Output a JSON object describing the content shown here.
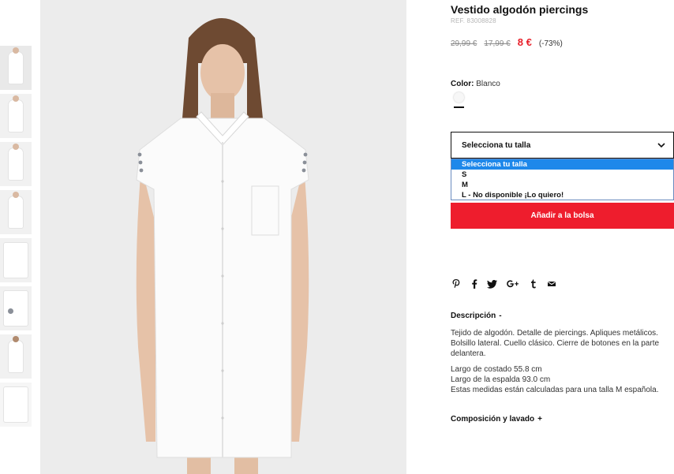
{
  "product": {
    "title": "Vestido algodón piercings",
    "ref": "REF. 83008828",
    "price_original": "29,99 €",
    "price_previous": "17,99 €",
    "price_now": "8 €",
    "discount": "(-73%)"
  },
  "color": {
    "label": "Color:",
    "value": "Blanco",
    "swatch_hex": "#f7f7f7"
  },
  "size_select": {
    "selected": "Selecciona tu talla",
    "options": [
      "Selecciona tu talla",
      "S",
      "M",
      "L - No disponible ¡Lo quiero!"
    ]
  },
  "add_button": "Añadir a la bolsa",
  "share_icons": [
    "pinterest-icon",
    "facebook-icon",
    "twitter-icon",
    "google-plus-icon",
    "tumblr-icon",
    "email-icon"
  ],
  "description": {
    "heading": "Descripción",
    "toggle": "-",
    "text": "Tejido de algodón. Detalle de piercings. Apliques metálicos. Bolsillo lateral. Cuello clásico. Cierre de botones en la parte delantera.",
    "measures": [
      "Largo de costado 55.8 cm",
      "Largo de la espalda 93.0 cm",
      "Estas medidas están calculadas para una talla M española."
    ]
  },
  "composition": {
    "heading": "Composición y lavado",
    "toggle": "+"
  },
  "colors": {
    "accent": "#ee1d2d",
    "sale_price": "#e8202a",
    "select_highlight": "#1e88ea"
  }
}
